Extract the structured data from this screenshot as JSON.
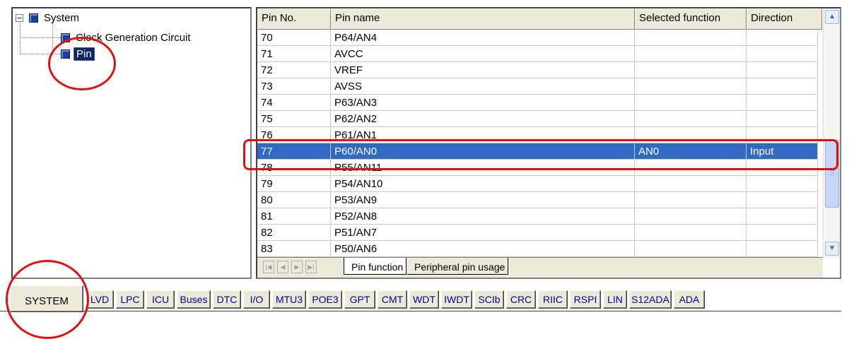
{
  "tree": {
    "root_label": "System",
    "expander": "−",
    "children": [
      {
        "label": "Clock Generation Circuit"
      },
      {
        "label": "Pin"
      }
    ]
  },
  "grid": {
    "columns": [
      "Pin No.",
      "Pin name",
      "Selected function",
      "Direction"
    ],
    "rows": [
      {
        "no": "70",
        "name": "P64/AN4",
        "function": "",
        "direction": ""
      },
      {
        "no": "71",
        "name": "AVCC",
        "function": "",
        "direction": ""
      },
      {
        "no": "72",
        "name": "VREF",
        "function": "",
        "direction": ""
      },
      {
        "no": "73",
        "name": "AVSS",
        "function": "",
        "direction": ""
      },
      {
        "no": "74",
        "name": "P63/AN3",
        "function": "",
        "direction": ""
      },
      {
        "no": "75",
        "name": "P62/AN2",
        "function": "",
        "direction": ""
      },
      {
        "no": "76",
        "name": "P61/AN1",
        "function": "",
        "direction": ""
      },
      {
        "no": "77",
        "name": "P60/AN0",
        "function": "AN0",
        "direction": "Input"
      },
      {
        "no": "78",
        "name": "P55/AN11",
        "function": "",
        "direction": ""
      },
      {
        "no": "79",
        "name": "P54/AN10",
        "function": "",
        "direction": ""
      },
      {
        "no": "80",
        "name": "P53/AN9",
        "function": "",
        "direction": ""
      },
      {
        "no": "81",
        "name": "P52/AN8",
        "function": "",
        "direction": ""
      },
      {
        "no": "82",
        "name": "P51/AN7",
        "function": "",
        "direction": ""
      },
      {
        "no": "83",
        "name": "P50/AN6",
        "function": "",
        "direction": ""
      }
    ],
    "selected_row": "77"
  },
  "sheet_tabs": [
    "Pin function",
    "Peripheral pin usage"
  ],
  "module_tabs": [
    "SYSTEM",
    "LVD",
    "LPC",
    "ICU",
    "Buses",
    "DTC",
    "I/O",
    "MTU3",
    "POE3",
    "GPT",
    "CMT",
    "WDT",
    "IWDT",
    "SCIb",
    "CRC",
    "RIIC",
    "RSPI",
    "LIN",
    "S12ADA",
    "ADA"
  ],
  "icons": {
    "scroll_up": "▲",
    "scroll_down": "▼",
    "nav_first": "|◀",
    "nav_prev": "◀",
    "nav_next": "▶",
    "nav_last": "▶|"
  },
  "colors": {
    "selection": "#316ac5",
    "annotation": "#e01010",
    "tab_text": "#0000a0"
  }
}
